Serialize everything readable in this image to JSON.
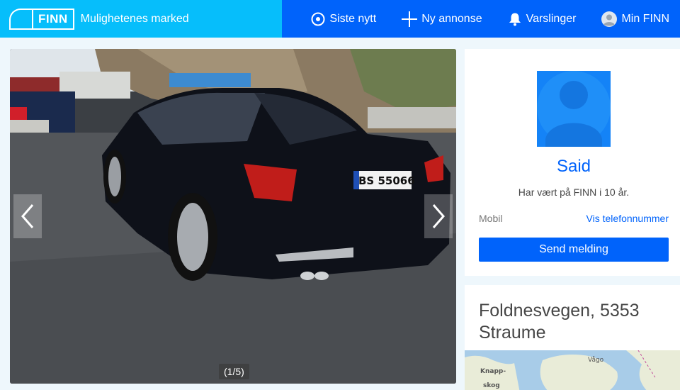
{
  "header": {
    "logo_text": "FINN",
    "tagline": "Mulighetenes marked",
    "nav": {
      "news": "Siste nytt",
      "new_ad": "Ny annonse",
      "notifications": "Varslinger",
      "profile": "Min FINN"
    },
    "colors": {
      "brand_bg": "#06befb",
      "nav_bg": "#0063fb"
    }
  },
  "gallery": {
    "counter": "(1/5)",
    "plate": "BS 55066"
  },
  "seller": {
    "name": "Said",
    "member_since": "Har vært på FINN i 10 år.",
    "mobile_label": "Mobil",
    "phone_link": "Vis telefonnummer",
    "send_button": "Send melding"
  },
  "location": {
    "address_line1": "Foldnesvegen, 5353",
    "address_line2": "Straume",
    "map_labels": [
      "Knapp-",
      "skog",
      "Vågo"
    ]
  }
}
